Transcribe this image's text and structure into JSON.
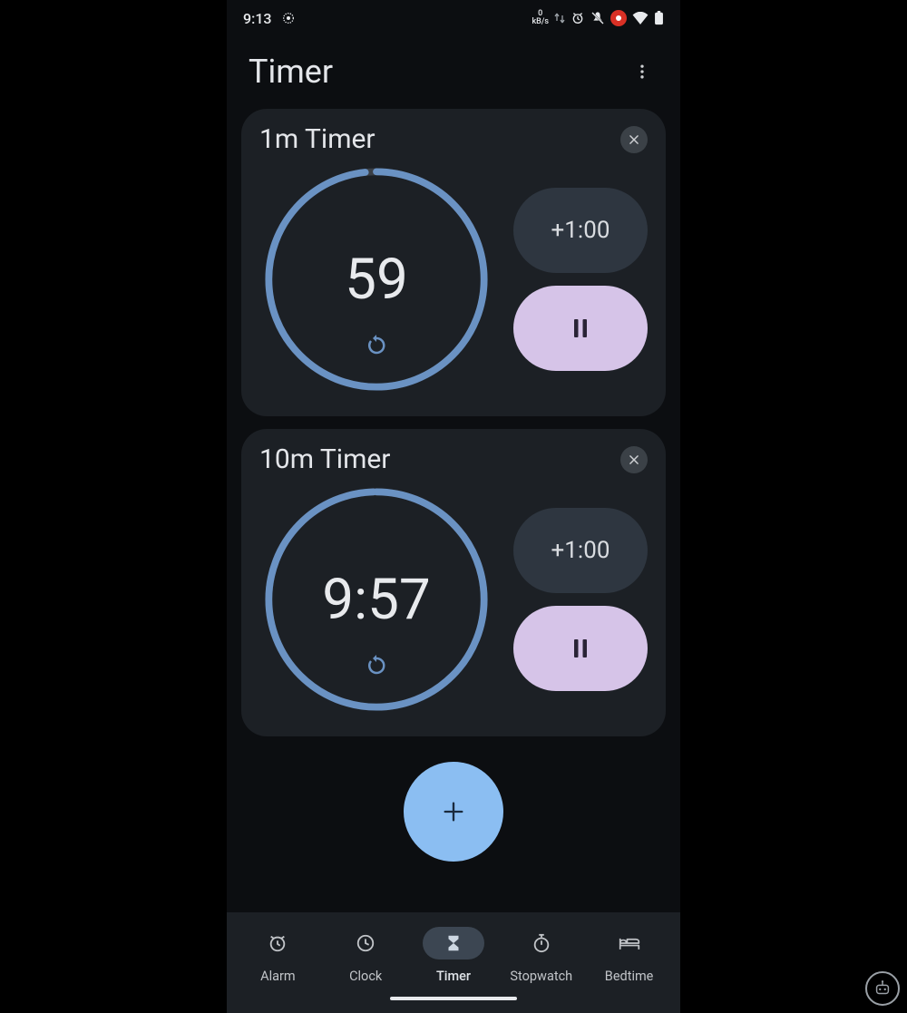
{
  "status_bar": {
    "time": "9:13",
    "net_rate_value": "0",
    "net_rate_unit": "kB/s"
  },
  "header": {
    "title": "Timer"
  },
  "timers": [
    {
      "title": "1m Timer",
      "display": "59",
      "add_label": "+1:00",
      "progress": 0.983
    },
    {
      "title": "10m Timer",
      "display": "9:57",
      "add_label": "+1:00",
      "progress": 0.995
    }
  ],
  "nav": {
    "items": [
      {
        "label": "Alarm"
      },
      {
        "label": "Clock"
      },
      {
        "label": "Timer"
      },
      {
        "label": "Stopwatch"
      },
      {
        "label": "Bedtime"
      }
    ],
    "active_index": 2
  },
  "colors": {
    "ring": "#6a92c3",
    "ring_track": "#3a3f46",
    "accent_pause": "#d6c4e8",
    "fab": "#8bbef2"
  }
}
